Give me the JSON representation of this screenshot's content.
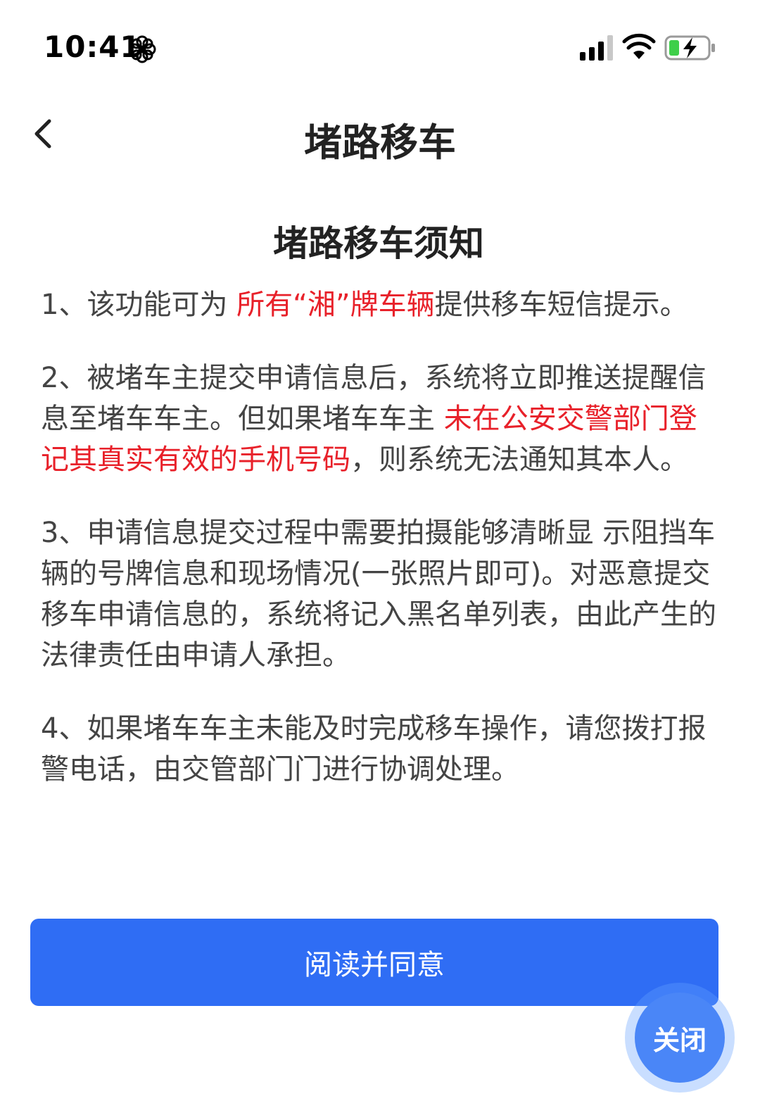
{
  "status_bar": {
    "time": "10:41",
    "icons": [
      "flower-icon",
      "signal-icon",
      "wifi-icon",
      "battery-charging-icon"
    ]
  },
  "nav": {
    "title": "堵路移车",
    "back_icon": "chevron-left-icon"
  },
  "notice": {
    "title": "堵路移车须知",
    "paragraphs": [
      {
        "before": "1、该功能可为 ",
        "highlight": "所有“湘”牌车辆",
        "after": "提供移车短信提示。"
      },
      {
        "before": "2、被堵车主提交申请信息后，系统将立即推送提醒信息至堵车车主。但如果堵车车主 ",
        "highlight": "未在公安交警部门登记其真实有效的手机号码",
        "after": "，则系统无法通知其本人。"
      },
      {
        "text": "3、申请信息提交过程中需要拍摄能够清晰显 示阻挡车辆的号牌信息和现场情况(一张照片即可)。对恶意提交移车申请信息的，系统将记入黑名单列表，由此产生的法律责任由申请人承担。"
      },
      {
        "text": "4、如果堵车车主未能及时完成移车操作，请您拨打报警电话，由交管部门门进行协调处理。"
      }
    ]
  },
  "actions": {
    "agree_label": "阅读并同意",
    "close_label": "关闭"
  },
  "colors": {
    "primary": "#2f6df4",
    "highlight": "#e8212a",
    "close_bubble": "#4a86f7"
  }
}
